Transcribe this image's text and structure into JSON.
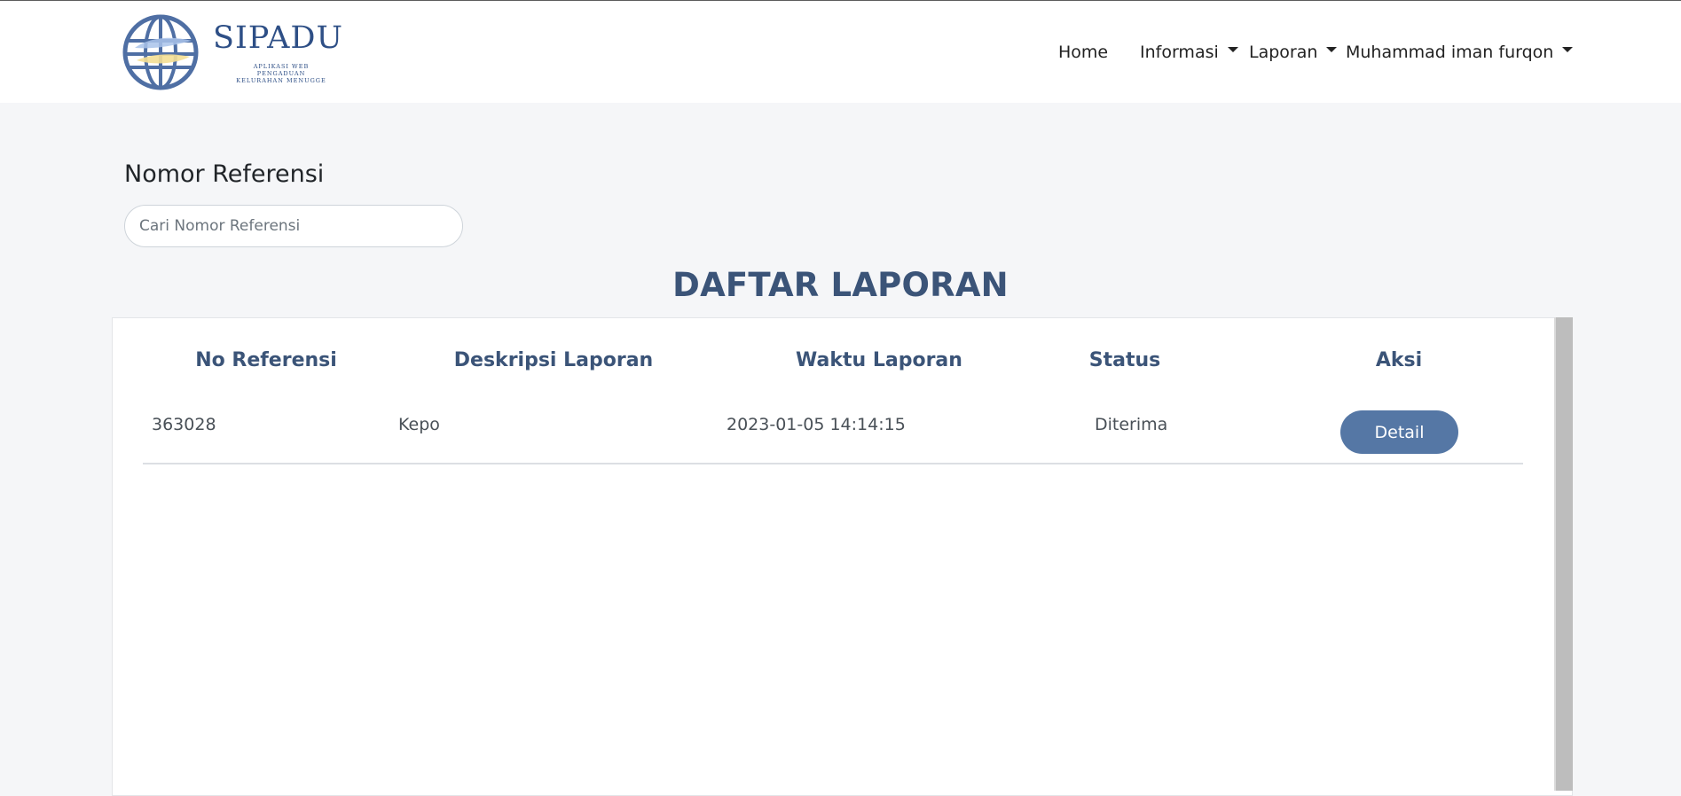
{
  "brand": {
    "name": "SIPADU",
    "tagline_line1": "APLIKASI WEB",
    "tagline_line2": "PENGADUAN",
    "tagline_line3": "KELURAHAN MENUGGE"
  },
  "nav": {
    "home": "Home",
    "informasi": "Informasi",
    "laporan": "Laporan",
    "user": "Muhammad iman furqon"
  },
  "search": {
    "label": "Nomor Referensi",
    "placeholder": "Cari Nomor Referensi",
    "value": ""
  },
  "table": {
    "title": "DAFTAR LAPORAN",
    "headers": [
      "No Referensi",
      "Deskripsi Laporan",
      "Waktu Laporan",
      "Status",
      "Aksi"
    ],
    "rows": [
      {
        "no_referensi": "363028",
        "deskripsi": "Kepo",
        "waktu": "2023-01-05 14:14:15",
        "status": "Diterima",
        "aksi_label": "Detail"
      }
    ]
  },
  "colors": {
    "brand": "#2e4f86",
    "heading": "#3b5478",
    "button": "#5577a5",
    "page_bg": "#f5f6f8"
  }
}
